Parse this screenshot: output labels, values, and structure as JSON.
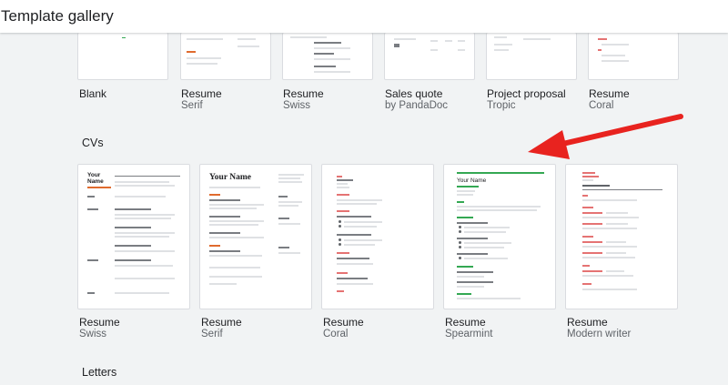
{
  "header": {
    "title": "Template gallery"
  },
  "top_row": [
    {
      "name": "Blank",
      "sub": ""
    },
    {
      "name": "Resume",
      "sub": "Serif"
    },
    {
      "name": "Resume",
      "sub": "Swiss"
    },
    {
      "name": "Sales quote",
      "sub": "by PandaDoc"
    },
    {
      "name": "Project proposal",
      "sub": "Tropic"
    },
    {
      "name": "Resume",
      "sub": "Coral"
    }
  ],
  "cvs": {
    "title": "CVs",
    "items": [
      {
        "name": "Resume",
        "sub": "Swiss",
        "preview_name": "Your Name"
      },
      {
        "name": "Resume",
        "sub": "Serif",
        "preview_name": "Your Name"
      },
      {
        "name": "Resume",
        "sub": "Coral",
        "preview_name": ""
      },
      {
        "name": "Resume",
        "sub": "Spearmint",
        "preview_name": "Your Name"
      },
      {
        "name": "Resume",
        "sub": "Modern writer",
        "preview_name": ""
      }
    ]
  },
  "letters": {
    "title": "Letters"
  },
  "colors": {
    "arrow": "#e8231f",
    "spearmint_accent": "#34a853",
    "coral_accent": "#e57373",
    "swiss_accent": "#e06b2e"
  }
}
